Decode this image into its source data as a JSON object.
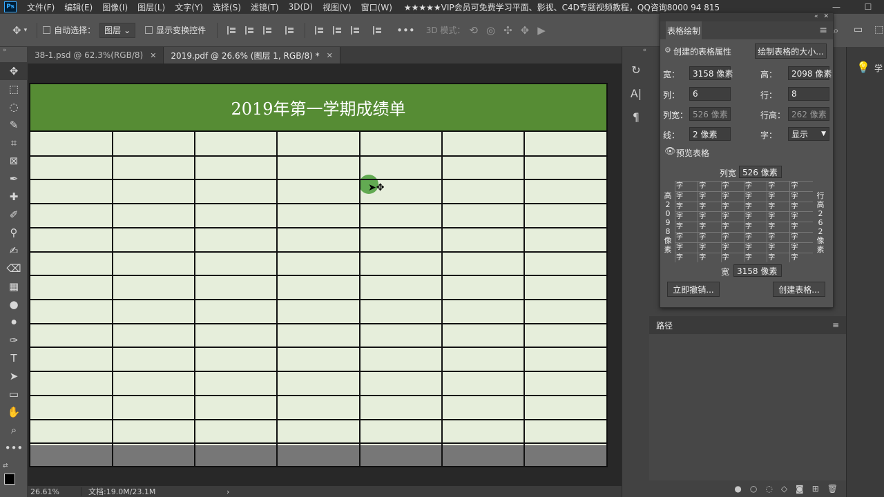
{
  "menu": {
    "logo": "Ps",
    "items": [
      "文件(F)",
      "编辑(E)",
      "图像(I)",
      "图层(L)",
      "文字(Y)",
      "选择(S)",
      "滤镜(T)",
      "3D(D)",
      "视图(V)",
      "窗口(W)"
    ],
    "promo": "★★★★★VIP会员可免费学习平面、影视、C4D专题视频教程，QQ咨询8000 94 815"
  },
  "options": {
    "auto_select_label": "自动选择：",
    "layer_select": "图层",
    "show_transform_label": "显示变换控件",
    "three_d_label": "3D 模式："
  },
  "tabs": [
    {
      "label": "38-1.psd @ 62.3%(RGB/8)",
      "active": false
    },
    {
      "label": "2019.pdf @ 26.6% (图层 1, RGB/8) *",
      "active": true
    }
  ],
  "document": {
    "title": "2019年第一学期成绩单",
    "columns": 7,
    "rows": 14,
    "header_color": "#568c34",
    "cell_color": "#e6eedb",
    "footer_color": "#777777"
  },
  "status": {
    "zoom": "26.61%",
    "doc_info": "文档:19.0M/23.1M",
    "arrow": "›"
  },
  "table_panel": {
    "title": "表格绘制",
    "section_label": "创建的表格属性",
    "size_button": "绘制表格的大小...",
    "width_label": "宽：",
    "width_value": "3158 像素",
    "height_label": "高：",
    "height_value": "2098 像素",
    "cols_label": "列：",
    "cols_value": "6",
    "rows_label": "行：",
    "rows_value": "8",
    "colw_label": "列宽：",
    "colw_value": "526 像素",
    "rowh_label": "行高：",
    "rowh_value": "262 像素",
    "line_label": "线：",
    "line_value": "2 像素",
    "char_label": "字：",
    "char_value": "显示",
    "preview_label": "预览表格",
    "preview_colw_label": "列宽",
    "preview_colw_value": "526 像素",
    "preview_w_label": "宽",
    "preview_w_value": "3158 像素",
    "preview_h_chars": [
      "高",
      "2",
      "0",
      "9",
      "8",
      "像",
      "素"
    ],
    "preview_rowh_chars": [
      "行",
      "高",
      "2",
      "6",
      "2",
      "像",
      "素"
    ],
    "cell_char": "字",
    "undo_button": "立即撤销...",
    "create_button": "创建表格..."
  },
  "paths_panel": {
    "title": "路径"
  },
  "right_edge_label": "学"
}
